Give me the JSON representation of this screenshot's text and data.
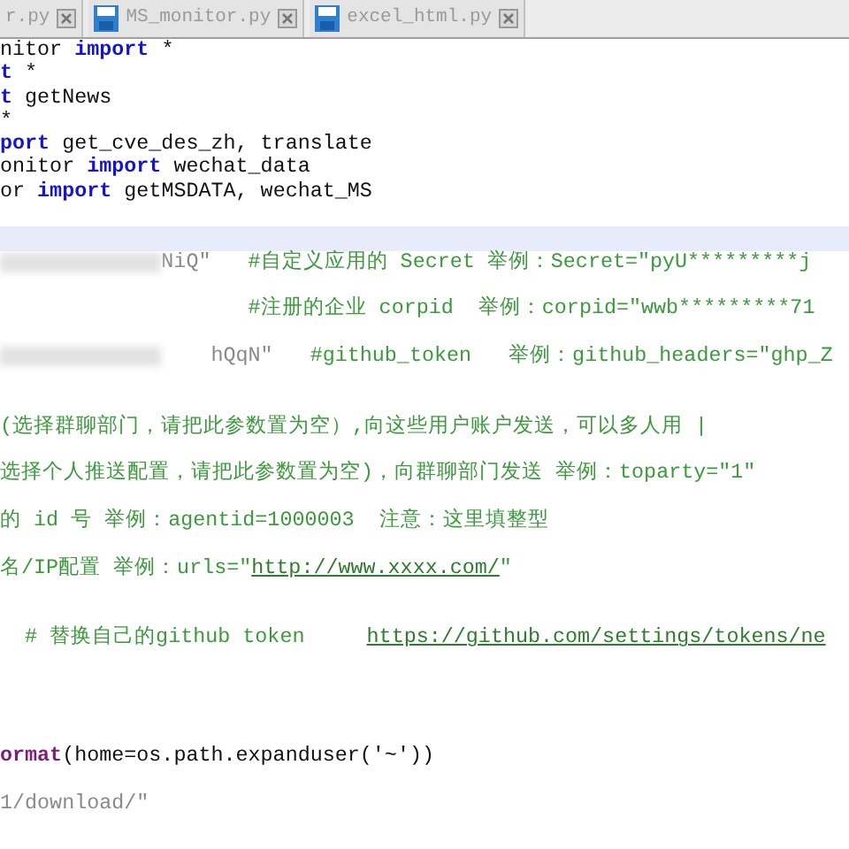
{
  "tabs": [
    {
      "label": "r.py",
      "icon": false
    },
    {
      "label": "MS_monitor.py",
      "icon": true
    },
    {
      "label": "excel_html.py",
      "icon": true
    }
  ],
  "lines": [
    {
      "kind": "code",
      "current": false,
      "segments": [
        {
          "kind": "plain",
          "text": "nitor "
        },
        {
          "kind": "kw",
          "text": "import"
        },
        {
          "kind": "plain",
          "text": " *"
        }
      ]
    },
    {
      "kind": "code",
      "current": false,
      "segments": [
        {
          "kind": "kw",
          "text": "t"
        },
        {
          "kind": "plain",
          "text": " *"
        }
      ]
    },
    {
      "kind": "code",
      "current": false,
      "segments": [
        {
          "kind": "kw",
          "text": "t"
        },
        {
          "kind": "plain",
          "text": " getNews"
        }
      ]
    },
    {
      "kind": "code",
      "current": false,
      "segments": [
        {
          "kind": "plain",
          "text": "*"
        }
      ]
    },
    {
      "kind": "code",
      "current": false,
      "segments": [
        {
          "kind": "kw",
          "text": "port"
        },
        {
          "kind": "plain",
          "text": " get_cve_des_zh, translate"
        }
      ]
    },
    {
      "kind": "code",
      "current": false,
      "segments": [
        {
          "kind": "plain",
          "text": "onitor "
        },
        {
          "kind": "kw",
          "text": "import"
        },
        {
          "kind": "plain",
          "text": " wechat_data"
        }
      ]
    },
    {
      "kind": "code",
      "current": false,
      "segments": [
        {
          "kind": "plain",
          "text": "or "
        },
        {
          "kind": "kw",
          "text": "import"
        },
        {
          "kind": "plain",
          "text": " getMSDATA, wechat_MS"
        }
      ]
    },
    {
      "kind": "blank",
      "current": false
    },
    {
      "kind": "blank",
      "current": true
    },
    {
      "kind": "code",
      "current": false,
      "segments": [
        {
          "kind": "redacted"
        },
        {
          "kind": "string",
          "text": "NiQ\""
        },
        {
          "kind": "comment",
          "text": "   #自定义应用的 Secret 举例：Secret=\"pyU*********j"
        }
      ]
    },
    {
      "kind": "blank",
      "current": false
    },
    {
      "kind": "code",
      "current": false,
      "segments": [
        {
          "kind": "comment",
          "text": "                    #注册的企业 corpid  举例：corpid=\"wwb*********71"
        }
      ]
    },
    {
      "kind": "blank",
      "current": false
    },
    {
      "kind": "code",
      "current": false,
      "segments": [
        {
          "kind": "redacted"
        },
        {
          "kind": "string",
          "text": "    hQqN\""
        },
        {
          "kind": "comment",
          "text": "   #github_token   举例：github_headers=\"ghp_Z"
        }
      ]
    },
    {
      "kind": "blank",
      "current": false
    },
    {
      "kind": "blank",
      "current": false
    },
    {
      "kind": "code",
      "current": false,
      "segments": [
        {
          "kind": "comment",
          "text": "(选择群聊部门，请把此参数置为空）,向这些用户账户发送，可以多人用 |"
        }
      ]
    },
    {
      "kind": "blank",
      "current": false
    },
    {
      "kind": "code",
      "current": false,
      "segments": [
        {
          "kind": "comment",
          "text": "选择个人推送配置，请把此参数置为空)，向群聊部门发送 举例：toparty=\"1\""
        }
      ]
    },
    {
      "kind": "blank",
      "current": false
    },
    {
      "kind": "code",
      "current": false,
      "segments": [
        {
          "kind": "comment",
          "text": "的 id 号 举例：agentid=1000003  注意：这里填整型"
        }
      ]
    },
    {
      "kind": "blank",
      "current": false
    },
    {
      "kind": "code",
      "current": false,
      "segments": [
        {
          "kind": "comment",
          "text": "名/IP配置 举例：urls=\""
        },
        {
          "kind": "link",
          "text": "http://www.xxxx.com/"
        },
        {
          "kind": "comment",
          "text": "\""
        }
      ]
    },
    {
      "kind": "blank",
      "current": false
    },
    {
      "kind": "blank",
      "current": false
    },
    {
      "kind": "code",
      "current": false,
      "segments": [
        {
          "kind": "comment",
          "text": "  # 替换自己的github token     "
        },
        {
          "kind": "link",
          "text": "https://github.com/settings/tokens/ne"
        }
      ]
    },
    {
      "kind": "blank",
      "current": false
    },
    {
      "kind": "blank",
      "current": false
    },
    {
      "kind": "blank",
      "current": false
    },
    {
      "kind": "blank",
      "current": false
    },
    {
      "kind": "code",
      "current": false,
      "segments": [
        {
          "kind": "func",
          "text": "ormat"
        },
        {
          "kind": "plain",
          "text": "(home=os.path.expanduser('~'))"
        }
      ]
    },
    {
      "kind": "blank",
      "current": false
    },
    {
      "kind": "code",
      "current": false,
      "segments": [
        {
          "kind": "string",
          "text": "1/download/\""
        }
      ]
    }
  ]
}
